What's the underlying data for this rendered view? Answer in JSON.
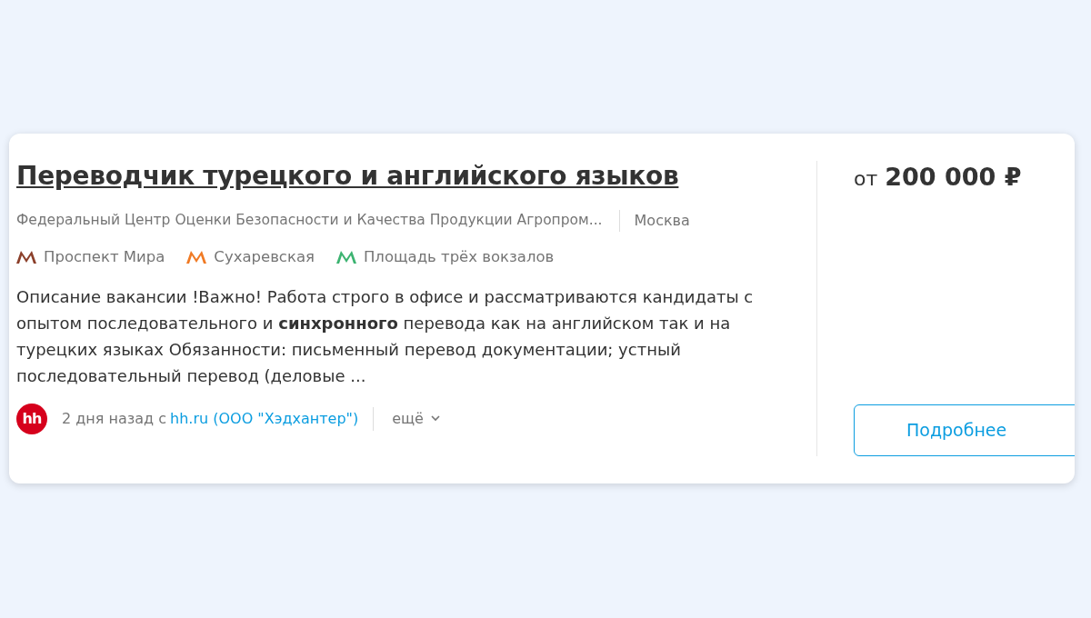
{
  "vacancy": {
    "title": "Переводчик турецкого и английского языков",
    "company": "Федеральный Центр Оценки Безопасности и Качества Продукции Агропром...",
    "city": "Москва",
    "metro": [
      {
        "name": "Проспект Мира",
        "color": "#8b3f2a"
      },
      {
        "name": "Сухаревская",
        "color": "#f07a24"
      },
      {
        "name": "Площадь трёх вокзалов",
        "color": "#3cb371"
      }
    ],
    "description": "Описание вакансии !Важно! Работа строго в офисе и рассматриваются кандидаты с опытом последовательного и **синхронного** перевода как на английском так и на турецких языках Обязанности: письменный перевод документации; устный последовательный перевод (деловые ...",
    "source_logo": "hh",
    "posted": "2 дня назад с",
    "source_link": "hh.ru (ООО \"Хэдхантер\")",
    "more": "ещё",
    "salary_prefix": "от",
    "salary": "200 000 ₽",
    "details_button": "Подробнее"
  }
}
